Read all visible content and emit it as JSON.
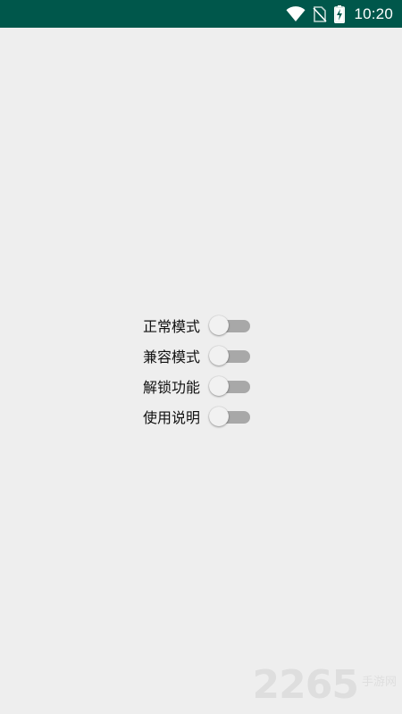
{
  "status_bar": {
    "time": "10:20",
    "background": "#00574b",
    "icons": [
      "wifi-icon",
      "no-sim-icon",
      "battery-charging-icon"
    ]
  },
  "toggles": [
    {
      "label": "正常模式",
      "on": false
    },
    {
      "label": "兼容模式",
      "on": false
    },
    {
      "label": "解锁功能",
      "on": false
    },
    {
      "label": "使用说明",
      "on": false
    }
  ],
  "watermark": {
    "number": "2265",
    "text": "手游网"
  },
  "colors": {
    "background": "#eeeeee",
    "switch_track_off": "#a8a8a8",
    "switch_thumb_off": "#f1f1f1"
  }
}
